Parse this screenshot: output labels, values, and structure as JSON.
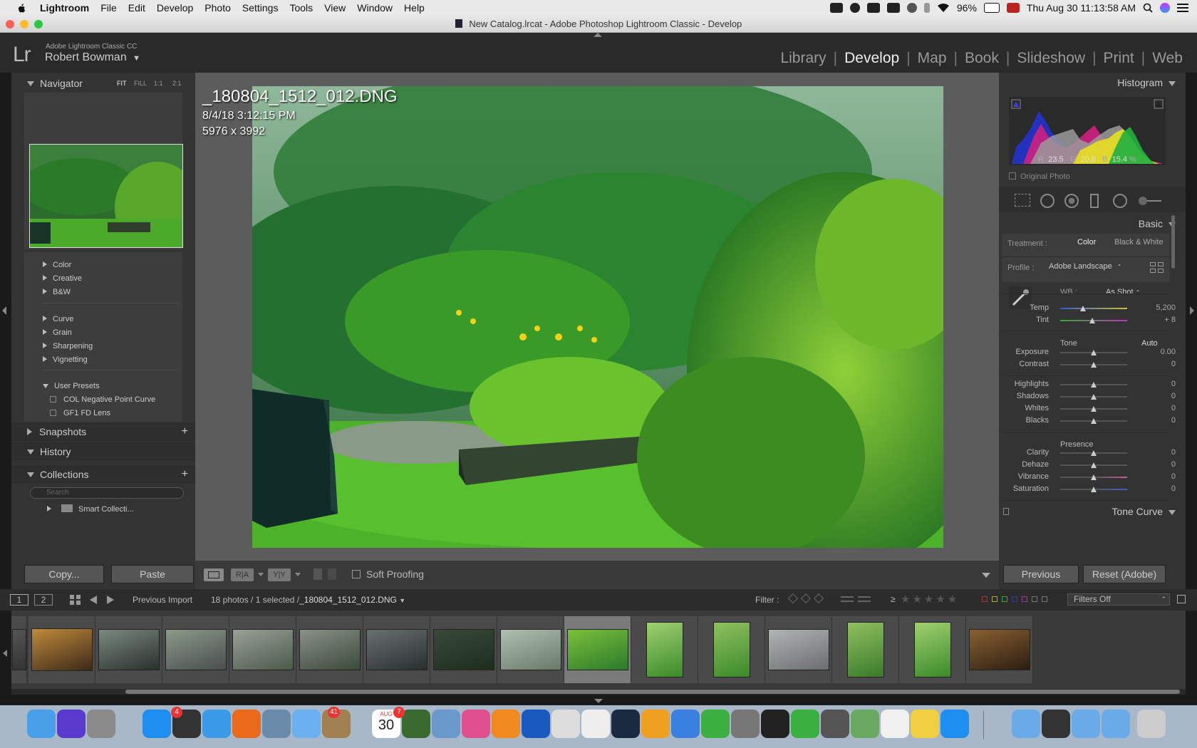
{
  "menubar": {
    "app": "Lightroom",
    "items": [
      "File",
      "Edit",
      "Develop",
      "Photo",
      "Settings",
      "Tools",
      "View",
      "Window",
      "Help"
    ],
    "battery": "96%",
    "clock": "Thu Aug 30  11:13:58 AM"
  },
  "window": {
    "title": "New Catalog.lrcat - Adobe Photoshop Lightroom Classic - Develop"
  },
  "identity": {
    "product": "Adobe Lightroom Classic CC",
    "user": "Robert Bowman",
    "logo": "Lr"
  },
  "modules": [
    "Library",
    "Develop",
    "Map",
    "Book",
    "Slideshow",
    "Print",
    "Web"
  ],
  "navigator": {
    "title": "Navigator",
    "zooms": [
      "FIT",
      "FILL",
      "1:1",
      "2:1"
    ]
  },
  "presets": {
    "groups": [
      "Color",
      "Creative",
      "B&W",
      "Curve",
      "Grain",
      "Sharpening",
      "Vignetting",
      "User Presets"
    ],
    "user_presets": [
      "COL Negative Point Curve",
      "GF1 FD Lens"
    ]
  },
  "left": {
    "snapshots": "Snapshots",
    "history": "History",
    "collections": "Collections",
    "search_placeholder": "Search",
    "smart": "Smart Collecti...",
    "copy": "Copy...",
    "paste": "Paste"
  },
  "photo": {
    "filename": "_180804_1512_012.DNG",
    "date": "8/4/18 3:12:15 PM",
    "dims": "5976 x 3992"
  },
  "toolbar": {
    "soft_proofing": "Soft Proofing"
  },
  "histogram": {
    "title": "Histogram",
    "r_label": "R",
    "r": "23.5",
    "g_label": "G",
    "g": "20.8",
    "b_label": "B",
    "b": "15.4",
    "pct": "%",
    "original": "Original Photo"
  },
  "basic": {
    "title": "Basic",
    "treatment_label": "Treatment :",
    "color": "Color",
    "bw": "Black & White",
    "profile_label": "Profile :",
    "profile": "Adobe Landscape",
    "wb_label": "WB :",
    "wb": "As Shot",
    "tone": "Tone",
    "auto": "Auto",
    "presence": "Presence",
    "sliders": [
      {
        "label": "Temp",
        "value": "5,200"
      },
      {
        "label": "Tint",
        "value": "+ 8"
      },
      {
        "label": "Exposure",
        "value": "0.00"
      },
      {
        "label": "Contrast",
        "value": "0"
      },
      {
        "label": "Highlights",
        "value": "0"
      },
      {
        "label": "Shadows",
        "value": "0"
      },
      {
        "label": "Whites",
        "value": "0"
      },
      {
        "label": "Blacks",
        "value": "0"
      },
      {
        "label": "Clarity",
        "value": "0"
      },
      {
        "label": "Dehaze",
        "value": "0"
      },
      {
        "label": "Vibrance",
        "value": "0"
      },
      {
        "label": "Saturation",
        "value": "0"
      }
    ]
  },
  "tone_curve": "Tone Curve",
  "right_buttons": {
    "previous": "Previous",
    "reset": "Reset (Adobe)"
  },
  "filmbar": {
    "screen1": "1",
    "screen2": "2",
    "source": "Previous Import",
    "count": "18 photos / 1 selected /",
    "selected": "_180804_1512_012.DNG",
    "filter": "Filter :",
    "gte": "≥",
    "filters_off": "Filters Off"
  },
  "dock": {
    "calendar_month": "AUG",
    "calendar_day": "30",
    "mail_badge": "41",
    "appstore_badge": "4",
    "cal_badge": "7"
  }
}
